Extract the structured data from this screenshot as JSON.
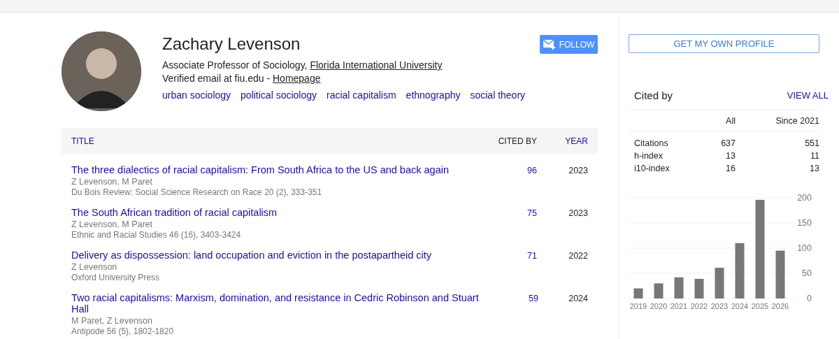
{
  "profile": {
    "name": "Zachary Levenson",
    "affiliation": "Associate Professor of Sociology, ",
    "affiliation_link": "Florida International University",
    "email": "Verified email at fiu.edu - ",
    "homepage_link": "Homepage",
    "interests": [
      "urban sociology",
      "political sociology",
      "racial capitalism",
      "ethnography",
      "social theory"
    ],
    "follow_button": "FOLLOW"
  },
  "articles": {
    "columns": {
      "title": "TITLE",
      "cited_by": "CITED BY",
      "year": "YEAR"
    },
    "rows": [
      {
        "title": "The three dialectics of racial capitalism: From South Africa to the US and back again",
        "authors": "Z Levenson, M Paret",
        "venue": "Du Bois Review: Social Science Research on Race 20 (2), 333-351",
        "cited_by": "96",
        "year": "2023"
      },
      {
        "title": "The South African tradition of racial capitalism",
        "authors": "Z Levenson, M Paret",
        "venue": "Ethnic and Racial Studies 46 (16), 3403-3424",
        "cited_by": "75",
        "year": "2023"
      },
      {
        "title": "Delivery as dispossession: land occupation and eviction in the postapartheid city",
        "authors": "Z Levenson",
        "venue": "Oxford University Press",
        "cited_by": "71",
        "year": "2022"
      },
      {
        "title": "Two racial capitalisms: Marxism, domination, and resistance in Cedric Robinson and Stuart Hall",
        "authors": "M Paret, Z Levenson",
        "venue": "Antipode 56 (5), 1802-1820",
        "cited_by": "59",
        "year": "2024"
      }
    ]
  },
  "sidebar": {
    "get_profile_button": "GET MY OWN PROFILE",
    "cited_by": {
      "title": "Cited by",
      "view_all": "VIEW ALL",
      "columns": [
        "All",
        "Since 2021"
      ],
      "rows": [
        {
          "label": "Citations",
          "all": "637",
          "since": "551"
        },
        {
          "label": "h-index",
          "all": "13",
          "since": "11"
        },
        {
          "label": "i10-index",
          "all": "16",
          "since": "13"
        }
      ]
    },
    "chart_data": {
      "type": "bar",
      "categories": [
        "2019",
        "2020",
        "2021",
        "2022",
        "2023",
        "2024",
        "2025",
        "2026"
      ],
      "values": [
        20,
        30,
        42,
        39,
        61,
        110,
        196,
        95
      ],
      "ylim": [
        0,
        200
      ],
      "grid": true,
      "yticks": [
        0,
        50,
        100,
        150,
        200
      ]
    }
  }
}
